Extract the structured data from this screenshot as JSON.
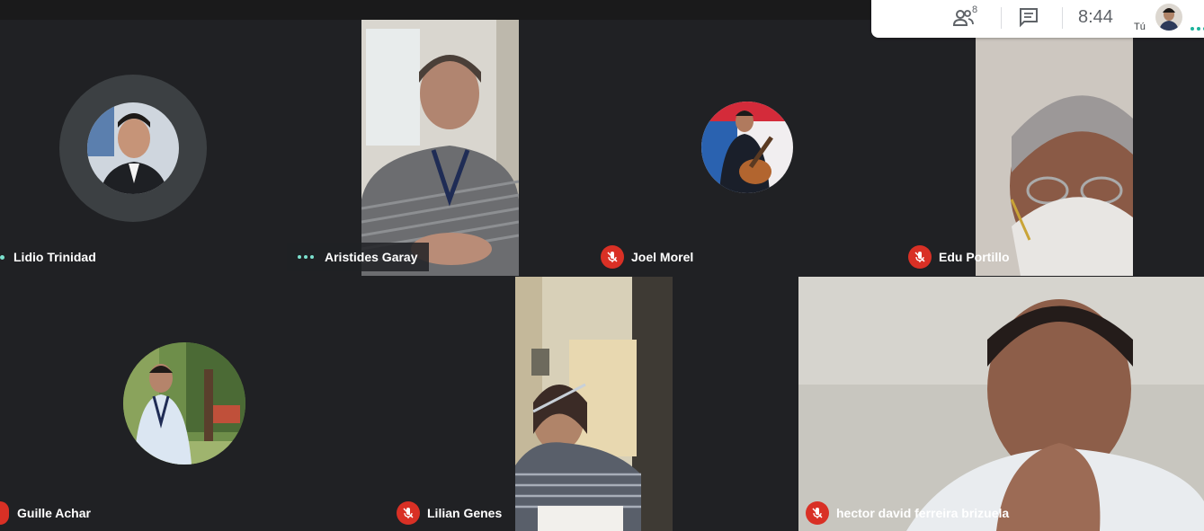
{
  "toolbar": {
    "participants_count": "8",
    "time": "8:44",
    "self_label": "Tú",
    "icons": [
      "people-icon",
      "chat-icon",
      "more-icon"
    ]
  },
  "participants": [
    {
      "name": "Lidio Trinidad",
      "status": "speaking"
    },
    {
      "name": "Aristides Garay",
      "status": "speaking"
    },
    {
      "name": "Joel Morel",
      "status": "muted"
    },
    {
      "name": "Edu Portillo",
      "status": "muted"
    },
    {
      "name": "Guille Achar",
      "status": "muted"
    },
    {
      "name": "Lilian Genes",
      "status": "muted"
    },
    {
      "name": "hector david ferreira brizuela",
      "status": "muted"
    }
  ],
  "colors": {
    "background": "#202124",
    "mic_muted": "#d93025",
    "speaking_dots": "#7ce2cf"
  }
}
